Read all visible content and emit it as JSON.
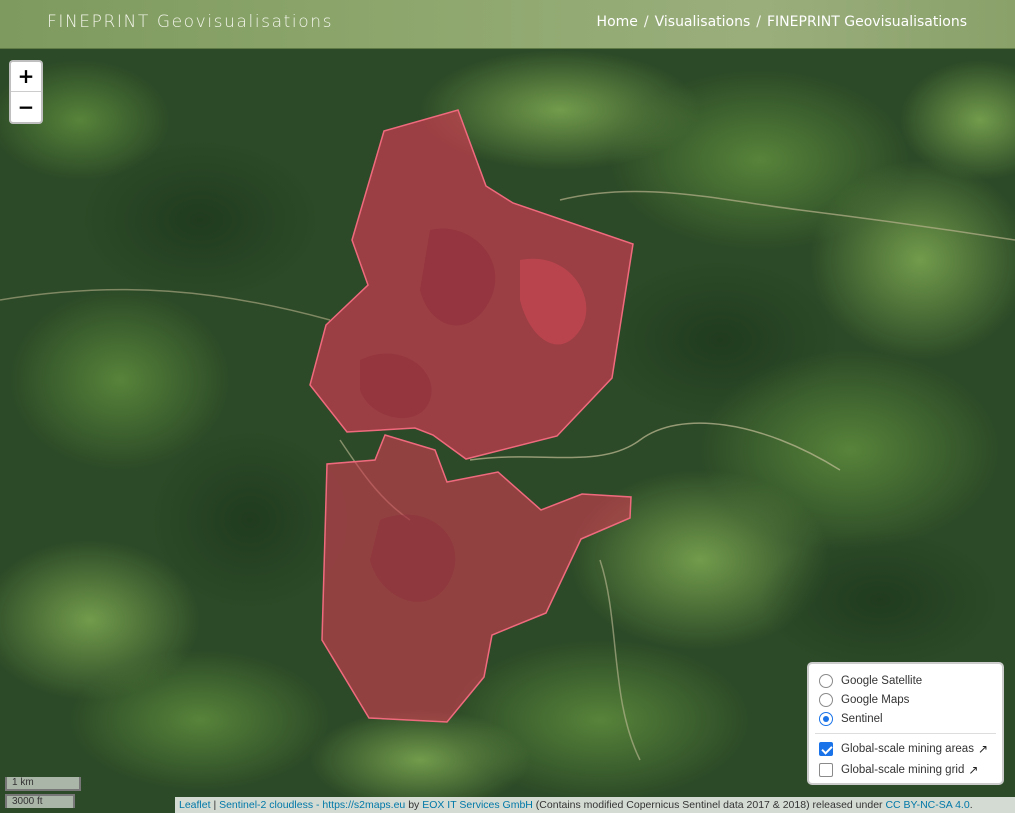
{
  "header": {
    "brand": "FINEPRINT Geovisualisations",
    "breadcrumbs": [
      {
        "label": "Home"
      },
      {
        "label": "Visualisations"
      },
      {
        "label": "FINEPRINT Geovisualisations"
      }
    ],
    "separator": "/"
  },
  "map": {
    "base_color": "#2f4a2a",
    "polygon_color": "#d23b53",
    "zoom_in": "+",
    "zoom_out": "−",
    "scale_metric": "1 km",
    "scale_imperial": "3000 ft"
  },
  "layers_control": {
    "base_layers": [
      {
        "label": "Google Satellite",
        "selected": false
      },
      {
        "label": "Google Maps",
        "selected": false
      },
      {
        "label": "Sentinel",
        "selected": true
      }
    ],
    "overlays": [
      {
        "label": "Global-scale mining areas",
        "checked": true
      },
      {
        "label": "Global-scale mining grid",
        "checked": false
      }
    ],
    "external_link_icon": "external-link-icon"
  },
  "attribution": {
    "leaflet": "Leaflet",
    "sep": " | ",
    "source": "Sentinel-2 cloudless - https://s2maps.eu",
    "by": " by ",
    "provider": "EOX IT Services GmbH",
    "note": " (Contains modified Copernicus Sentinel data 2017 & 2018) released under ",
    "license": "CC BY-NC-SA 4.0",
    "end": "."
  }
}
